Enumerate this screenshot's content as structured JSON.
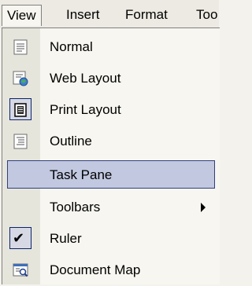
{
  "menubar": {
    "view": "View",
    "insert": "Insert",
    "format": "Format",
    "tools": "Too"
  },
  "menu": {
    "items": [
      {
        "id": "normal",
        "label": "Normal",
        "icon": "normal-view-icon"
      },
      {
        "id": "web-layout",
        "label": "Web Layout",
        "icon": "web-layout-icon"
      },
      {
        "id": "print-layout",
        "label": "Print Layout",
        "icon": "print-layout-icon",
        "selected": true
      },
      {
        "id": "outline",
        "label": "Outline",
        "icon": "outline-view-icon"
      },
      {
        "id": "task-pane",
        "label": "Task Pane",
        "highlighted": true
      },
      {
        "id": "toolbars",
        "label": "Toolbars",
        "submenu": true
      },
      {
        "id": "ruler",
        "label": "Ruler",
        "checked": true
      },
      {
        "id": "document-map",
        "label": "Document Map",
        "icon": "document-map-icon"
      }
    ]
  }
}
